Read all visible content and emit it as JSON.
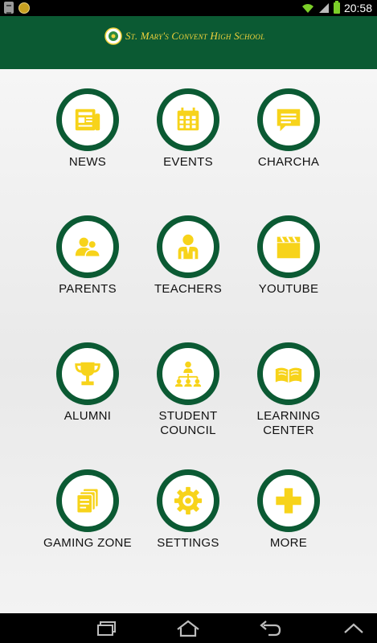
{
  "status_bar": {
    "time": "20:58",
    "icons": [
      "notification-doc-icon",
      "notification-app-icon",
      "wifi-icon",
      "signal-icon",
      "battery-icon"
    ]
  },
  "header": {
    "title": "St. Mary's Convent High School",
    "logo": "school-crest-icon",
    "background_color": "#0b5a33",
    "title_color": "#f2d33c"
  },
  "tiles": [
    {
      "label": "NEWS",
      "icon": "newspaper-icon"
    },
    {
      "label": "EVENTS",
      "icon": "calendar-icon"
    },
    {
      "label": "CHARCHA",
      "icon": "chat-bubble-icon"
    },
    {
      "label": "PARENTS",
      "icon": "parents-icon"
    },
    {
      "label": "TEACHERS",
      "icon": "teacher-icon"
    },
    {
      "label": "YOUTUBE",
      "icon": "clapperboard-icon"
    },
    {
      "label": "ALUMNI",
      "icon": "trophy-icon"
    },
    {
      "label": "STUDENT COUNCIL",
      "icon": "org-chart-icon"
    },
    {
      "label": "LEARNING CENTER",
      "icon": "open-book-icon"
    },
    {
      "label": "GAMING ZONE",
      "icon": "cards-icon"
    },
    {
      "label": "SETTINGS",
      "icon": "gear-icon"
    },
    {
      "label": "MORE",
      "icon": "plus-icon"
    }
  ],
  "accent_colors": {
    "ring": "#0b5a33",
    "icon": "#f7d31a"
  },
  "nav_bar": {
    "buttons": [
      "recent-apps-icon",
      "home-icon",
      "back-icon",
      "menu-up-icon"
    ]
  }
}
